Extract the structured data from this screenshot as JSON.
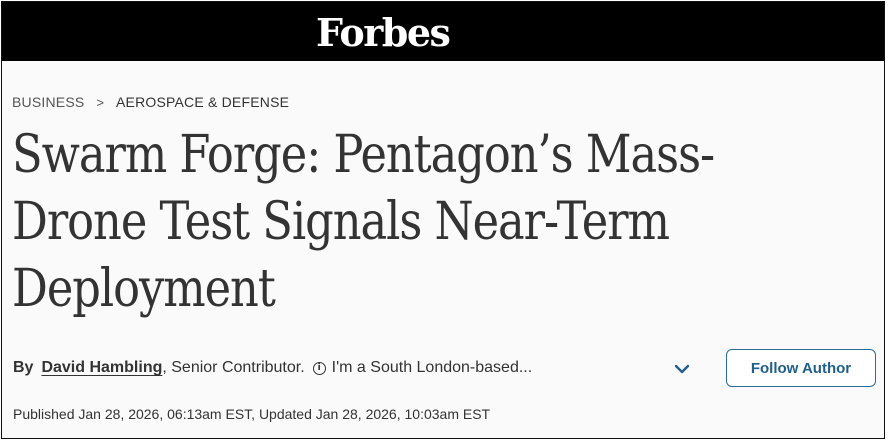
{
  "masthead": {
    "logo_text": "Forbes"
  },
  "breadcrumb": {
    "items": [
      "BUSINESS",
      "AEROSPACE & DEFENSE"
    ],
    "separator": ">"
  },
  "article": {
    "headline": "Swarm Forge: Pentagon’s Mass-Drone Test Signals Near-Term Deployment",
    "byline_prefix": "By",
    "author_name": "David Hambling",
    "author_role": ", Senior Contributor.",
    "info_icon_glyph": "i",
    "author_bio_snippet": "I'm a South London-based...",
    "expand_icon": "chevron-down-icon",
    "follow_label": "Follow Author",
    "dates": "Published Jan 28, 2026, 06:13am EST, Updated Jan 28, 2026, 10:03am EST"
  },
  "colors": {
    "masthead_bg": "#000000",
    "accent_blue": "#1f5f8b",
    "text": "#333333"
  }
}
